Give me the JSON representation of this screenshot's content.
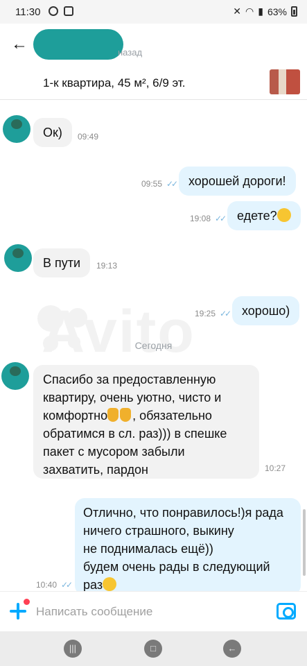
{
  "status_bar": {
    "time": "11:30",
    "battery": "63%"
  },
  "header": {
    "status_text": "назад"
  },
  "listing": {
    "title": "1-к квартира, 45 м², 6/9 эт."
  },
  "chat": {
    "day_separator": "Сегодня",
    "messages": [
      {
        "dir": "in",
        "text": "Ок)",
        "time": "09:49"
      },
      {
        "dir": "out",
        "text": "хорошей дороги!",
        "time": "09:55"
      },
      {
        "dir": "out",
        "text": "едете?",
        "time": "19:08",
        "emoji": "smile"
      },
      {
        "dir": "in",
        "text": "В пути",
        "time": "19:13"
      },
      {
        "dir": "out",
        "text": "хорошо)",
        "time": "19:25"
      },
      {
        "dir": "in",
        "lines": [
          "Спасибо за предоставленную",
          "квартиру, очень уютно, чисто и",
          "комфортно",
          ", обязательно",
          "обратимся в сл. раз))) в спешке",
          "пакет с мусором забыли",
          "захватить, пардон"
        ],
        "time": "10:27"
      },
      {
        "dir": "out",
        "lines": [
          "Отлично, что понравилось!)я рада",
          "ничего страшного, выкину",
          "не поднималась ещё))",
          "будем очень рады в следующий",
          "раз"
        ],
        "time": "10:40"
      }
    ]
  },
  "composer": {
    "placeholder": "Написать сообщение"
  },
  "watermark": "Avito",
  "colors": {
    "accent": "#00aaff",
    "incoming_bubble": "#f2f2f2",
    "outgoing_bubble": "#e3f4fe",
    "avatar": "#1e9e9a",
    "notification_dot": "#ff4053"
  }
}
